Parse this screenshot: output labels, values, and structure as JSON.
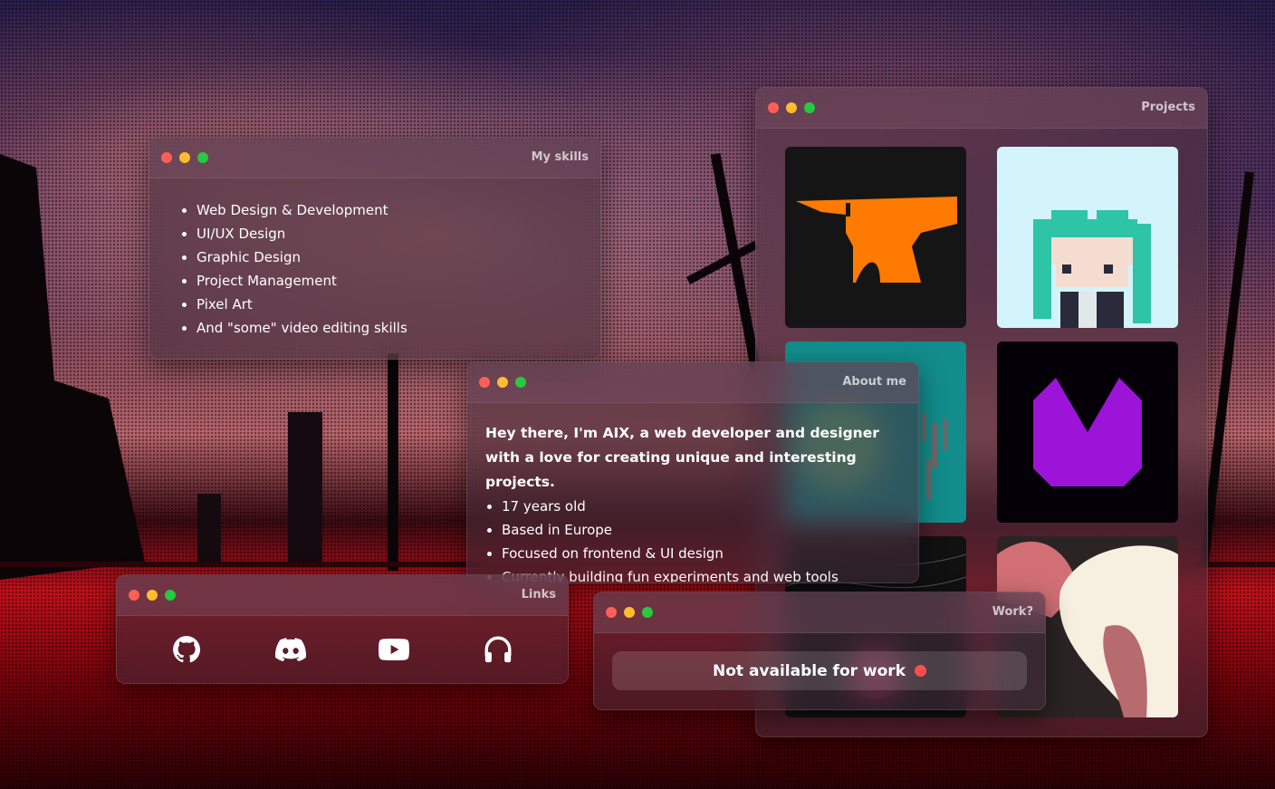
{
  "windows": {
    "skills": {
      "title": "My skills",
      "items": [
        "Web Design & Development",
        "UI/UX Design",
        "Graphic Design",
        "Project Management",
        "Pixel Art",
        "And \"some\" video editing skills"
      ]
    },
    "projects": {
      "title": "Projects"
    },
    "about": {
      "title": "About me",
      "intro": "Hey there, I'm AIX, a web developer and designer with a love for creating unique and interesting projects.",
      "items": [
        "17 years old",
        "Based in Europe",
        "Focused on frontend & UI design",
        "Currently building fun experiments and web tools"
      ]
    },
    "links": {
      "title": "Links",
      "icons": [
        "github-icon",
        "discord-icon",
        "youtube-icon",
        "headphones-icon"
      ]
    },
    "work": {
      "title": "Work?",
      "status_text": "Not available for work",
      "status_color": "#ff4d4d"
    }
  },
  "colors": {
    "dot_red": "#ff5f57",
    "dot_yellow": "#febc2e",
    "dot_green": "#28c840",
    "anvil_orange": "#ff7a00",
    "miku_teal": "#2ec4a6",
    "logo_purple": "#9b14d8"
  }
}
